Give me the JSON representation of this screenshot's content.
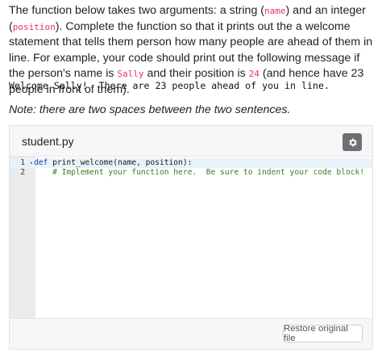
{
  "instructions": {
    "p1": "The function below takes two arguments: a string (",
    "arg_name": "name",
    "p2": ") and an integer (",
    "arg_position": "position",
    "p3": "). Complete the function so that it prints out the a welcome statement that tells them person how many people are ahead of them in line. For example, your code should print out the following message if the person's name is ",
    "example_name": "Sally",
    "p4": " and their position is ",
    "example_position": "24",
    "p5": " (and hence have 23 people in front of them)."
  },
  "expected_output": "Welcome Sally!  There are 23 people ahead of you in line.",
  "note": "Note: there are two spaces between the two sentences.",
  "editor": {
    "filename": "student.py",
    "settings_icon": "gear-icon",
    "lines": [
      {
        "number": "1",
        "keyword": "def",
        "rest": " print_welcome(name, position):"
      },
      {
        "number": "2",
        "comment": "    # Implement your function here.  Be sure to indent your code block!"
      }
    ],
    "restore_label": "Restore original file"
  },
  "colors": {
    "inline_code": "#e0317a",
    "keyword": "#1f3fa8",
    "comment": "#3a7d1f",
    "gear_button": "#6d7176"
  }
}
